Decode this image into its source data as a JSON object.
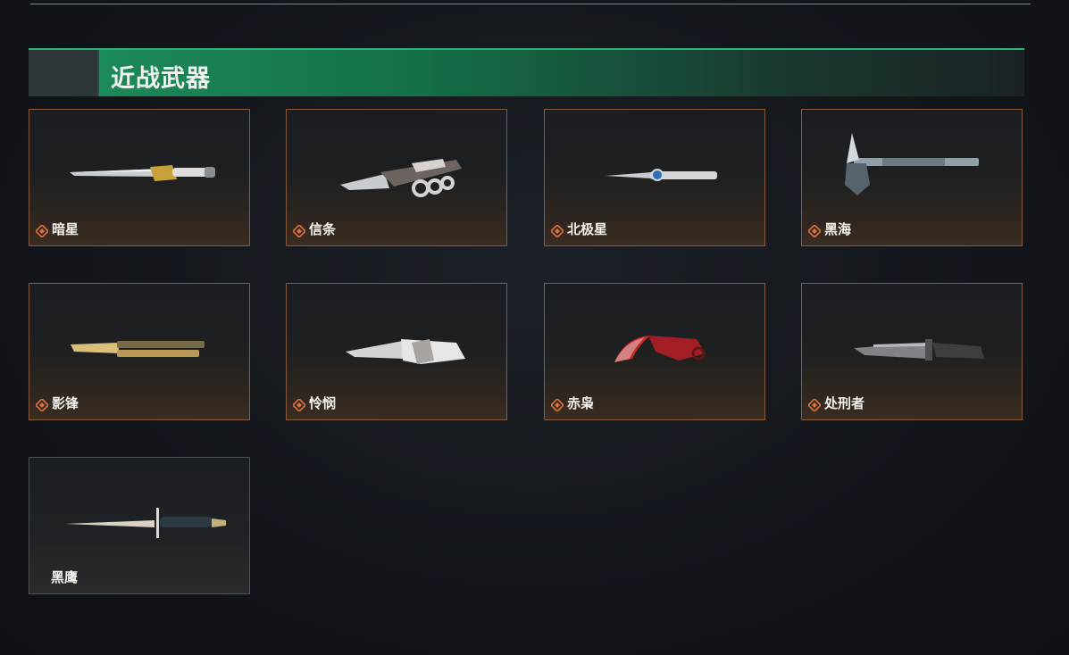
{
  "section": {
    "title": "近战武器"
  },
  "weapons": [
    {
      "name": "暗星",
      "icon": "rarity-diamond-icon"
    },
    {
      "name": "信条",
      "icon": "rarity-diamond-icon"
    },
    {
      "name": "北极星",
      "icon": "rarity-diamond-icon"
    },
    {
      "name": "黑海",
      "icon": "rarity-diamond-icon"
    },
    {
      "name": "影锋",
      "icon": "rarity-diamond-icon"
    },
    {
      "name": "怜悯",
      "icon": "rarity-diamond-icon"
    },
    {
      "name": "赤枭",
      "icon": "rarity-diamond-icon"
    },
    {
      "name": "处刑者",
      "icon": "rarity-diamond-icon"
    },
    {
      "name": "黑鹰"
    }
  ],
  "colors": {
    "accent_green": "#1c8a5a",
    "card_border": "#8a5a3e",
    "rarity_orange": "#e0733a"
  }
}
